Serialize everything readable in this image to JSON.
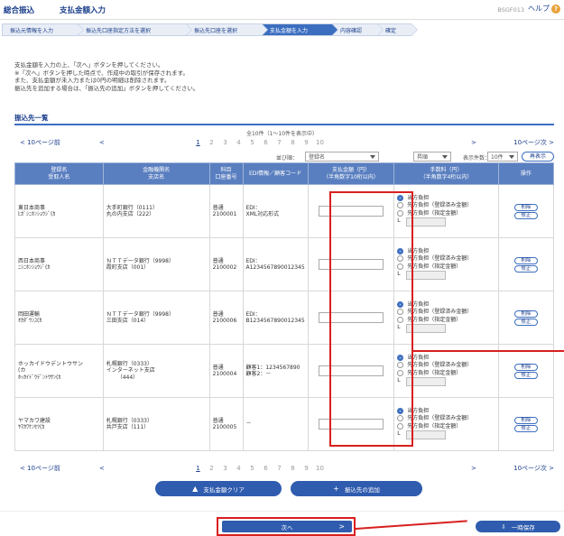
{
  "header": {
    "section": "総合振込",
    "title": "支払金額入力",
    "screen_code": "BSGF013",
    "help_label": "ヘルプ",
    "help_icon": "?"
  },
  "steps": [
    {
      "label": "振込元情報を入力",
      "active": false
    },
    {
      "label": "振込先口座指定方法を選択",
      "active": false
    },
    {
      "label": "振込先口座を選択",
      "active": false
    },
    {
      "label": "支払金額を入力",
      "active": true
    },
    {
      "label": "内容確認",
      "active": false
    },
    {
      "label": "確定",
      "active": false
    }
  ],
  "instructions": [
    "支払金額を入力の上、「次へ」ボタンを押してください。",
    "※「次へ」ボタンを押した時点で、作成中の取引が保存されます。",
    "また、支払金額が未入力または0円の明細は削除されます。",
    "振込先を追加する場合は、「振込先の追加」ボタンを押してください。"
  ],
  "list_title": "振込先一覧",
  "count_text": "全10件（1～10件を表示中）",
  "pager": {
    "prev10": "10ページ前",
    "prev_icon": "<",
    "pages": [
      "1",
      "2",
      "3",
      "4",
      "5",
      "6",
      "7",
      "8",
      "9",
      "10"
    ],
    "current": "1",
    "next_icon": ">",
    "next10": "10ページ次"
  },
  "sort": {
    "label": "並び順：",
    "field": "登録名",
    "order": "昇順",
    "per_page_label": "表示件数：",
    "per_page": "10件",
    "redisplay": "再表示"
  },
  "columns": {
    "name": [
      "登録名",
      "受取人名"
    ],
    "bank": [
      "金融機関名",
      "支店名"
    ],
    "account": [
      "科目",
      "口座番号"
    ],
    "edi": "EDI情報／顧客コード",
    "amount": [
      "支払金額（円）",
      "（半角数字10桁以内）"
    ],
    "fee": [
      "手数料（円）",
      "（半角数字4桁以内）"
    ],
    "ops": "操作"
  },
  "fee_options": {
    "self": "当方負担",
    "other_registered": "先方負担（登録済み金額）",
    "other_specified": "先方負担（指定金額）",
    "prefix": "L"
  },
  "ops_labels": {
    "delete": "削除",
    "edit": "修正"
  },
  "rows": [
    {
      "name": "東日本商事",
      "kana": "ﾋｶﾞｼﾆﾎﾝｼｮｳｼﾞ(ｶ",
      "bank": "大手町銀行（0111）",
      "branch": "丸の内支店（222）",
      "branch2": "",
      "type": "普通",
      "number": "2100001",
      "edi1": "EDI：",
      "edi2": "XML対応形式",
      "amount": ""
    },
    {
      "name": "西日本商事",
      "kana": "ﾆｼﾆﾎﾝｼｮｳｼﾞ(ｶ",
      "bank": "ＮＴＴデータ銀行（9998）",
      "branch": "霞町支店（001）",
      "branch2": "",
      "type": "普通",
      "number": "2100002",
      "edi1": "EDI：",
      "edi2": "A1234567890012345",
      "amount": ""
    },
    {
      "name": "岡田運輸",
      "kana": "ｵｶﾀﾞｳﾝﾕ(ｶ",
      "bank": "ＮＴＴデータ銀行（9998）",
      "branch": "三田支店（014）",
      "branch2": "",
      "type": "普通",
      "number": "2100006",
      "edi1": "EDI：",
      "edi2": "B1234567890012345",
      "amount": ""
    },
    {
      "name": "ホッカイドウデントウサン",
      "kana": "(カ",
      "kana2": "ﾎｯｶｲﾄﾞｳﾃﾞﾝﾄｳｻﾝ(ｶ",
      "bank": "札幌銀行（0333）",
      "branch": "インターネット支店",
      "branch2": "（444）",
      "type": "普通",
      "number": "2100004",
      "edi1": "顧客1：1234567890",
      "edi2": "顧客2：－",
      "amount": ""
    },
    {
      "name": "ヤマカワ建設",
      "kana": "ﾔﾏｶﾜｹﾝｾﾂ(ｶ",
      "bank": "札幌銀行（0333）",
      "branch": "共戸支店（111）",
      "branch2": "",
      "type": "普通",
      "number": "2100005",
      "edi1": "－",
      "edi2": "",
      "amount": ""
    }
  ],
  "buttons": {
    "clear": "支払金額クリア",
    "clear_icon": "▲",
    "add": "振込先の追加",
    "add_icon": "+",
    "next": "次へ",
    "next_icon": ">",
    "save": "一時保存",
    "save_icon": "⇩"
  },
  "highlight_color": "#d81f1f",
  "accent_color": "#2f5cae"
}
